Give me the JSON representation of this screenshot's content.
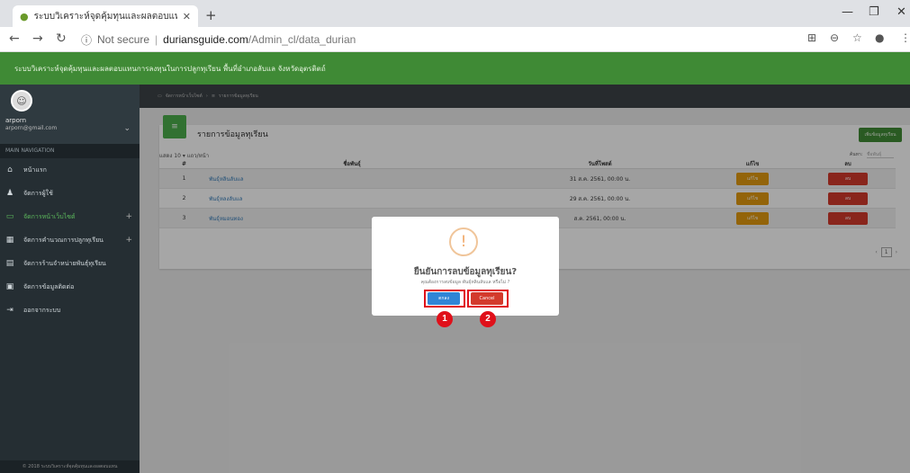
{
  "browser": {
    "tab_title": "ระบบวิเคราะห์จุดคุ้มทุนและผลตอบแทน",
    "url_security": "Not secure",
    "url_domain": "duriansguide.com",
    "url_path": "/Admin_cl/data_durian"
  },
  "app": {
    "header_title": "ระบบวิเคราะห์จุดคุ้มทุนและผลตอบแทนการลงทุนในการปลูกทุเรียน พื้นที่อำเภอลับแล จังหวัดอุตรดิตถ์"
  },
  "sidebar": {
    "user_name": "arporn",
    "user_email": "arporn@gmail.com",
    "nav_header": "MAIN NAVIGATION",
    "items": [
      {
        "label": "หน้าแรก"
      },
      {
        "label": "จัดการผู้ใช้"
      },
      {
        "label": "จัดการหน้าเว็บไซต์"
      },
      {
        "label": "จัดการคำนวณการปลูกทุเรียน"
      },
      {
        "label": "จัดการร้านจำหน่ายพันธุ์ทุเรียน"
      },
      {
        "label": "จัดการข้อมูลติดต่อ"
      },
      {
        "label": "ออกจากระบบ"
      }
    ],
    "footer": "© 2018 ระบบวิเคราะห์จุดคุ้มทุนและผลตอบแทน"
  },
  "breadcrumb": {
    "home": "จัดการหน้าเว็บไซต์",
    "current": "รายการข้อมูลทุเรียน"
  },
  "card": {
    "title": "รายการข้อมูลทุเรียน",
    "add_button": "เพิ่มข้อมูลทุเรียน",
    "show_prefix": "แสดง",
    "show_value": "10",
    "show_suffix": "แถว/หน้า",
    "search_label": "ค้นหา:",
    "search_placeholder": "ชื่อพันธุ์"
  },
  "table": {
    "headers": {
      "num": "#",
      "name": "ชื่อพันธุ์",
      "date": "วันที่โพสต์",
      "edit": "แก้ไข",
      "delete": "ลบ"
    },
    "rows": [
      {
        "num": "1",
        "name": "พันธุ์หลินลับแล",
        "date": "31 ส.ค. 2561, 00:00 น.",
        "edit": "แก้ไข",
        "delete": "ลบ"
      },
      {
        "num": "2",
        "name": "พันธุ์หลงลับแล",
        "date": "29 ส.ค. 2561, 00:00 น.",
        "edit": "แก้ไข",
        "delete": "ลบ"
      },
      {
        "num": "3",
        "name": "พันธุ์หมอนทอง",
        "date": "ส.ค. 2561, 00:00 น.",
        "edit": "แก้ไข",
        "delete": "ลบ"
      }
    ]
  },
  "pager": {
    "prev": "‹",
    "page": "1",
    "next": "›"
  },
  "modal": {
    "icon": "!",
    "title": "ยืนยันการลบข้อมูลทุเรียน?",
    "text": "คุณต้องการลบข้อมูล พันธุ์หลินลับแล หรือไม่ ?",
    "confirm": "ตกลง",
    "cancel": "Cancel"
  },
  "annotations": {
    "badge1": "1",
    "badge2": "2"
  }
}
